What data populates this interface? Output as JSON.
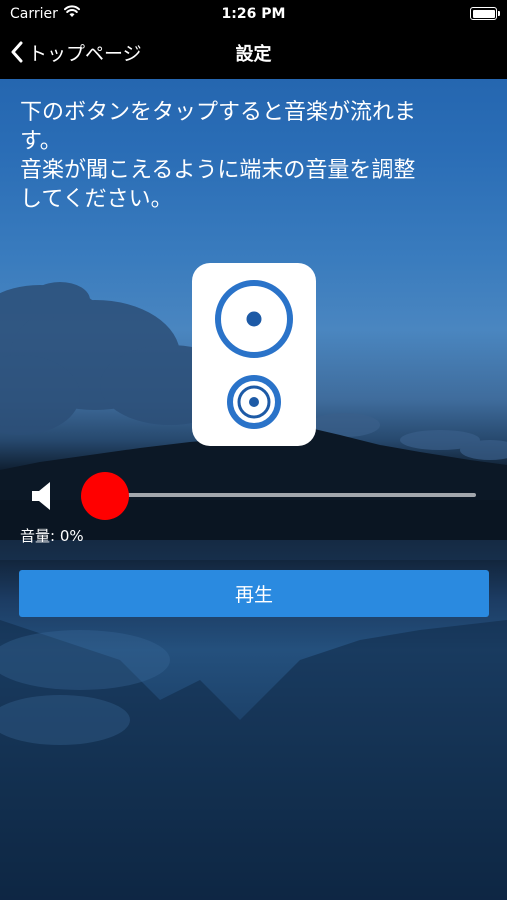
{
  "status_bar": {
    "carrier": "Carrier",
    "time": "1:26 PM"
  },
  "nav": {
    "back_label": "トップページ",
    "title": "設定"
  },
  "instruction": {
    "line1": "下のボタンをタップすると音楽が流れま",
    "line2": "す。",
    "line3": "音楽が聞こえるように端末の音量を調整",
    "line4": "してください。"
  },
  "volume": {
    "label": "音量: 0%",
    "level": 0
  },
  "play_button": {
    "label": "再生"
  },
  "colors": {
    "accent": "#2a8ae0",
    "slider_thumb": "#ff0000",
    "speaker_blue": "#2a73c9",
    "speaker_dark_blue": "#1d5aa6"
  },
  "icons": [
    "wifi-icon",
    "battery-icon",
    "back-chevron-icon",
    "speaker-icon",
    "volume-icon"
  ]
}
